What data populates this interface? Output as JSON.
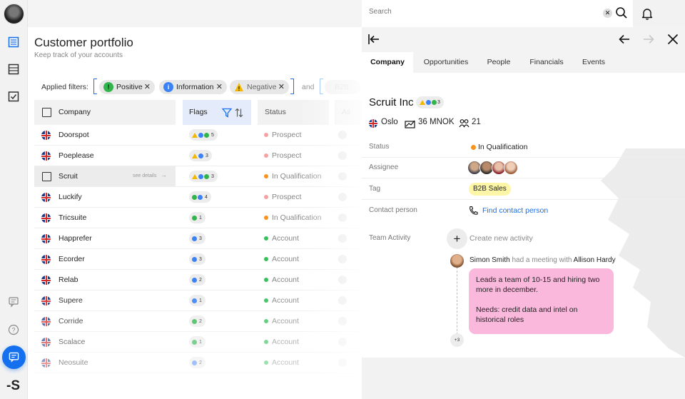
{
  "rail": {
    "items": [
      "list",
      "board",
      "checklist"
    ],
    "bottom_icons": [
      "feedback",
      "help",
      "chat"
    ],
    "logo": "-S"
  },
  "page": {
    "title": "Customer portfolio",
    "subtitle": "Keep track of your accounts"
  },
  "filters": {
    "label": "Applied filters:",
    "chips": [
      {
        "label": "Positive",
        "color": "#2fb54a",
        "glyph": "!"
      },
      {
        "label": "Information",
        "color": "#3b82f6",
        "glyph": "i"
      },
      {
        "label": "Negative",
        "color": "#f5b800",
        "glyph": "!"
      }
    ],
    "and": "and",
    "next_chip": "B2B"
  },
  "table": {
    "columns": [
      "Company",
      "Flags",
      "Status",
      "As"
    ],
    "see_details": "see details",
    "rows": [
      {
        "name": "Doorspot",
        "flags": [
          "warn",
          "info",
          "pos"
        ],
        "count": "5",
        "status": "Prospect",
        "status_color": "#f7a1a1"
      },
      {
        "name": "Poeplease",
        "flags": [
          "warn",
          "info"
        ],
        "count": "3",
        "status": "Prospect",
        "status_color": "#f7a1a1"
      },
      {
        "name": "Scruit",
        "flags": [
          "warn",
          "info",
          "pos"
        ],
        "count": "3",
        "status": "In Qualification",
        "status_color": "#f7941d",
        "selected": true
      },
      {
        "name": "Luckify",
        "flags": [
          "pos",
          "info"
        ],
        "count": "4",
        "status": "Prospect",
        "status_color": "#f7a1a1"
      },
      {
        "name": "Tricsuite",
        "flags": [
          "pos"
        ],
        "count": "1",
        "status": "In Qualification",
        "status_color": "#f7941d"
      },
      {
        "name": "Happrefer",
        "flags": [
          "info"
        ],
        "count": "3",
        "status": "Account",
        "status_color": "#37c15a"
      },
      {
        "name": "Ecorder",
        "flags": [
          "info"
        ],
        "count": "3",
        "status": "Account",
        "status_color": "#37c15a"
      },
      {
        "name": "Relab",
        "flags": [
          "info"
        ],
        "count": "2",
        "status": "Account",
        "status_color": "#37c15a"
      },
      {
        "name": "Supere",
        "flags": [
          "info"
        ],
        "count": "1",
        "status": "Account",
        "status_color": "#37c15a"
      },
      {
        "name": "Corride",
        "flags": [
          "pos"
        ],
        "count": "2",
        "status": "Account",
        "status_color": "#37c15a"
      },
      {
        "name": "Scalace",
        "flags": [
          "pos"
        ],
        "count": "1",
        "status": "Account",
        "status_color": "#37c15a"
      },
      {
        "name": "Neosuite",
        "flags": [
          "info"
        ],
        "count": "2",
        "status": "Account",
        "status_color": "#37c15a"
      }
    ]
  },
  "search": {
    "placeholder": "Search",
    "value": ""
  },
  "detail": {
    "tabs": [
      "Company",
      "Opportunities",
      "People",
      "Financials",
      "Events"
    ],
    "company": {
      "name": "Scruit Inc",
      "badge_count": "3",
      "city": "Oslo",
      "revenue": "36 MNOK",
      "employees": "21"
    },
    "fields": {
      "status_label": "Status",
      "status_value": "In Qualification",
      "assignee_label": "Assignee",
      "tag_label": "Tag",
      "tag_value": "B2B Sales",
      "contact_label": "Contact person",
      "contact_value": "Find contact person"
    },
    "team": {
      "label": "Team Activity",
      "add_label": "Create new activity",
      "actor": "Simon Smith",
      "action": "had a meeting with",
      "target": "Allison Hardy",
      "note": "Leads a team of 10-15 and hiring two more in december.\n\nNeeds: credit data and intel on historical roles",
      "more": "+3"
    }
  },
  "colors": {
    "accent": "#1570ef",
    "positive": "#2fb54a",
    "info": "#3b82f6",
    "warning": "#f5b800",
    "note_bg": "#fbb8dd",
    "tag_bg": "#fdf6a6"
  }
}
